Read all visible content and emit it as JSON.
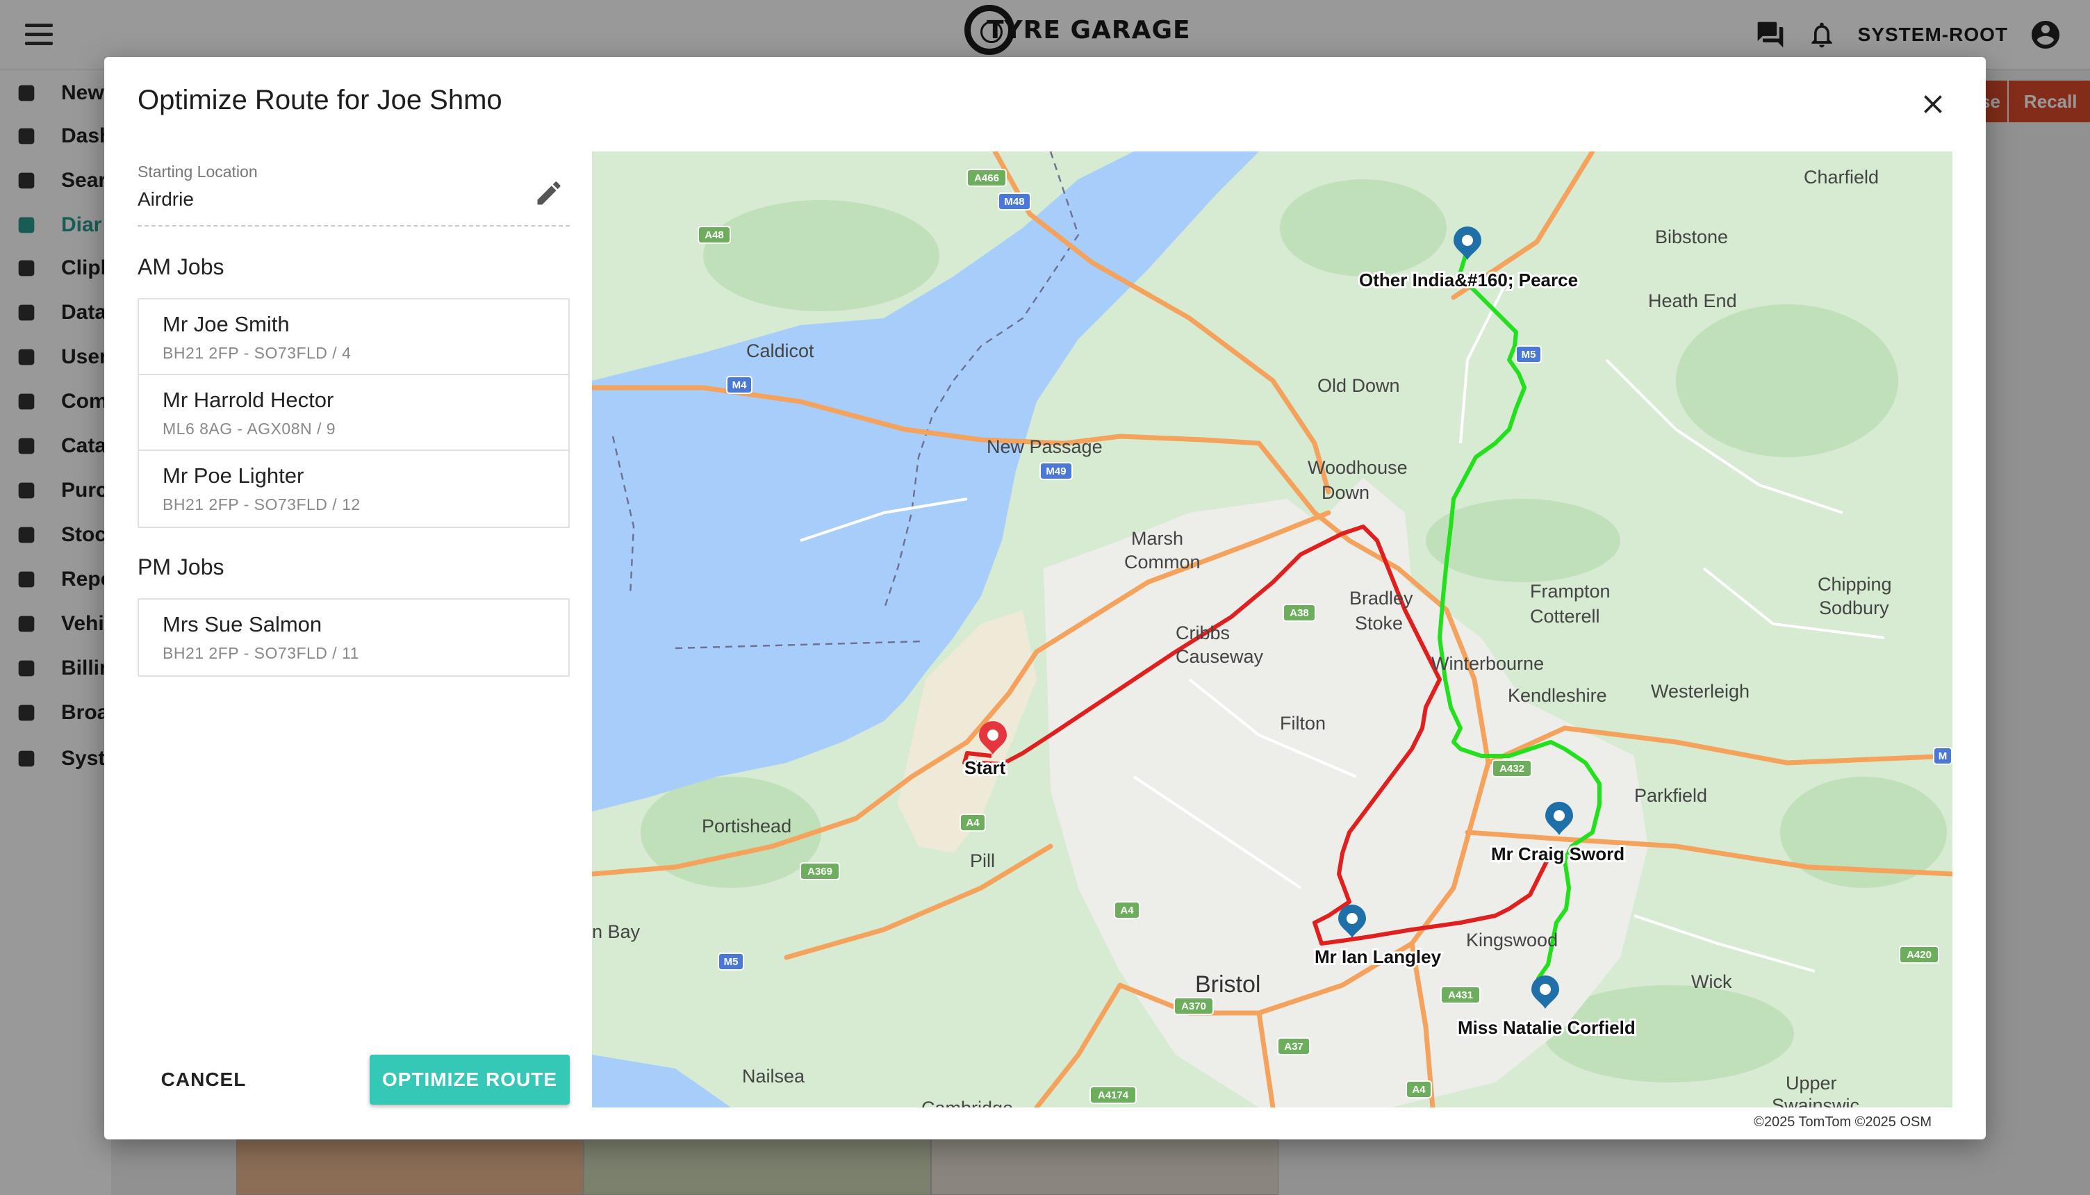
{
  "app": {
    "brand": "TYRE GARAGE",
    "user": "SYSTEM-ROOT"
  },
  "sidebar": {
    "items": [
      {
        "label": "New",
        "icon": "plus-icon"
      },
      {
        "label": "Dash",
        "icon": "dashboard-icon"
      },
      {
        "label": "Sear",
        "icon": "search-icon"
      },
      {
        "label": "Diar",
        "icon": "calendar-icon",
        "active": true
      },
      {
        "label": "Clipb",
        "icon": "clipboard-icon"
      },
      {
        "label": "Data",
        "icon": "upload-icon"
      },
      {
        "label": "User",
        "icon": "users-icon"
      },
      {
        "label": "Com",
        "icon": "company-icon"
      },
      {
        "label": "Cata",
        "icon": "book-icon"
      },
      {
        "label": "Purc",
        "icon": "receipt-icon"
      },
      {
        "label": "Stoc",
        "icon": "location-icon"
      },
      {
        "label": "Repo",
        "icon": "report-icon"
      },
      {
        "label": "Vehi",
        "icon": "car-icon"
      },
      {
        "label": "Billir",
        "icon": "billing-icon"
      },
      {
        "label": "Broa",
        "icon": "megaphone-icon"
      },
      {
        "label": "Syst",
        "icon": "gear-icon"
      }
    ]
  },
  "background_buttons": {
    "close_label": "se",
    "recall_label": "Recall"
  },
  "modal": {
    "title": "Optimize Route for Joe Shmo",
    "starting_location": {
      "label": "Starting Location",
      "value": "Airdrie"
    },
    "am_title": "AM Jobs",
    "am_jobs": [
      {
        "name": "Mr Joe Smith",
        "detail": "BH21 2FP - SO73FLD / 4"
      },
      {
        "name": "Mr Harrold Hector",
        "detail": "ML6 8AG - AGX08N / 9"
      },
      {
        "name": "Mr Poe Lighter",
        "detail": "BH21 2FP - SO73FLD / 12"
      }
    ],
    "pm_title": "PM Jobs",
    "pm_jobs": [
      {
        "name": "Mrs Sue Salmon",
        "detail": "BH21 2FP - SO73FLD / 11"
      }
    ],
    "cancel_label": "CANCEL",
    "optimize_label": "OPTIMIZE ROUTE",
    "attribution": "©2025 TomTom  ©2025 OSM"
  },
  "map": {
    "places": [
      "Charfield",
      "Bibstone",
      "Heath End",
      "Caldicot",
      "Old Down",
      "New Passage",
      "Woodhouse",
      "Down",
      "Marsh",
      "Common",
      "Bradley",
      "Stoke",
      "Frampton",
      "Cotterell",
      "Chipping",
      "Sodbury",
      "Cribbs",
      "Causeway",
      "Winterbourne",
      "Kendleshire",
      "Westerleigh",
      "Filton",
      "Parkfield",
      "Portishead",
      "Pill",
      "Kingswood",
      "Wick",
      "n Bay",
      "Bristol",
      "Nailsea",
      "Cambridge",
      "Upper",
      "Swainswic"
    ],
    "roads": [
      "A466",
      "M48",
      "A48",
      "M5",
      "M4",
      "M49",
      "A38",
      "A432",
      "A4",
      "A369",
      "A4",
      "M5",
      "A431",
      "A370",
      "A37",
      "A4174",
      "A4",
      "A420",
      "M"
    ],
    "pins": [
      {
        "label": "Start",
        "color": "#e5353f"
      },
      {
        "label": "Other India&#160; Pearce",
        "color": "#1f6fa8"
      },
      {
        "label": "Mr Craig Sword",
        "color": "#1f6fa8"
      },
      {
        "label": "Mr Ian Langley",
        "color": "#1f6fa8"
      },
      {
        "label": "Miss Natalie  Corfield",
        "color": "#1f6fa8"
      }
    ],
    "routes": {
      "am_color": "#e01f1f",
      "pm_color": "#22e01c"
    },
    "water_color": "#a7cdfa",
    "land_color": "#d7ead2"
  }
}
